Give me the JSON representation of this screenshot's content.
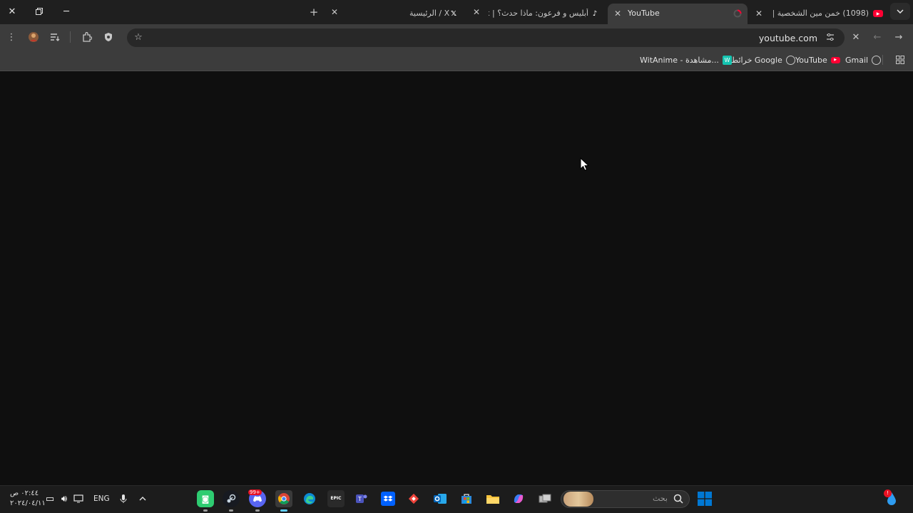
{
  "tabs": [
    {
      "title": "(1098) خمن مين الشخصية | ...",
      "favicon": "youtube-icon",
      "active": false
    },
    {
      "title": "YouTube",
      "favicon": "loading-spinner-icon",
      "active": true
    },
    {
      "title": "أبليس و فرعون: ماذا حدث؟ | TikTok",
      "favicon": "tiktok-icon",
      "active": false
    },
    {
      "title": "الرئيسية / X",
      "favicon": "x-icon",
      "active": false
    }
  ],
  "new_tab_label": "+",
  "address_bar": {
    "url": "youtube.com"
  },
  "bookmarks": [
    {
      "label": "Gmail",
      "icon": "globe-icon"
    },
    {
      "label": "YouTube",
      "icon": "youtube-icon"
    },
    {
      "label": "خرائط Google",
      "icon": "globe-icon"
    },
    {
      "label": "WitAnime - مشاهدة...",
      "icon": "witanime-icon"
    }
  ],
  "taskbar": {
    "search_placeholder": "بحث",
    "language": "ENG",
    "time": "٠٢:٤٤ ص",
    "date": "٢٠٢٤/٠٤/١١",
    "notification_badge": "!",
    "discord_badge": "99+"
  },
  "colors": {
    "youtube_red": "#ff0033",
    "content_bg": "#0f0f0f",
    "toolbar_bg": "#3c3c3c",
    "tabstrip_bg": "#1f1f1f",
    "windows_blue": "#0078d4"
  }
}
